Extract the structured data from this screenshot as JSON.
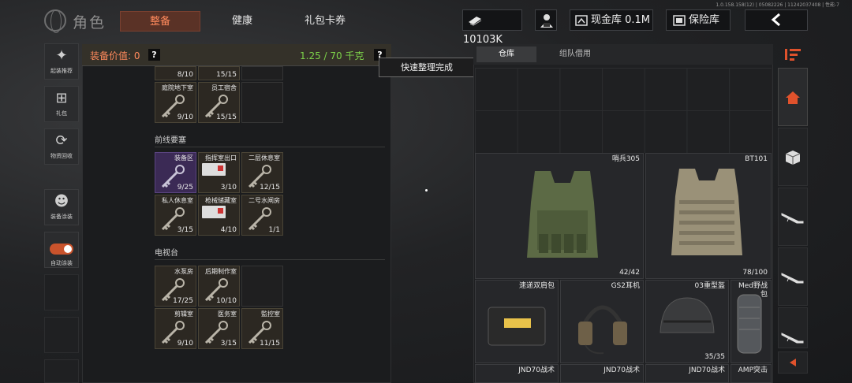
{
  "header": {
    "title": "角色",
    "tabs": [
      {
        "label": "整备",
        "active": true
      },
      {
        "label": "健康",
        "active": false
      },
      {
        "label": "礼包卡券",
        "active": false
      }
    ],
    "version": "1.0.158.158(12) | 05082226 | 11242037408 | 性能-7",
    "currency": "10103K",
    "cash_vault": "现金库 0.1M",
    "safe": "保险库",
    "accent": "#ff8a5c"
  },
  "left_menu": [
    {
      "label": "起装推荐",
      "icon": "loadout-icon"
    },
    {
      "label": "礼包",
      "icon": "gift-icon"
    },
    {
      "label": "物资回收",
      "icon": "recycle-icon"
    },
    {
      "label": "装备涂装",
      "icon": "paint-icon"
    },
    {
      "label": "自动涂装",
      "icon": "toggle-icon"
    }
  ],
  "keys_panel": {
    "equip_value_label": "装备价值: 0",
    "help": "?",
    "weight": "1.25 / 70 千克",
    "weight_color": "#7dd34a",
    "top_partial": [
      {
        "count": "8/10"
      },
      {
        "count": "15/15"
      }
    ],
    "top_row": [
      {
        "name": "庭院地下室",
        "count": "9/10"
      },
      {
        "name": "员工宿舍",
        "count": "15/15"
      }
    ],
    "sections": [
      {
        "title": "前线要塞",
        "items": [
          {
            "name": "装备区",
            "count": "9/25",
            "rare": true
          },
          {
            "name": "指挥室出口",
            "count": "3/10",
            "card": true
          },
          {
            "name": "二层休息室",
            "count": "12/15"
          },
          {
            "name": "私人休息室",
            "count": "3/15"
          },
          {
            "name": "枪械储藏室",
            "count": "4/10",
            "card": true
          },
          {
            "name": "二号水闸房",
            "count": "1/1"
          }
        ]
      },
      {
        "title": "电视台",
        "items": [
          {
            "name": "水泵房",
            "count": "17/25"
          },
          {
            "name": "后期制作室",
            "count": "10/10"
          },
          {
            "name": "剪辑室",
            "count": "9/10"
          },
          {
            "name": "医务室",
            "count": "3/15"
          },
          {
            "name": "監控室",
            "count": "11/15"
          }
        ]
      }
    ]
  },
  "toast": "快速整理完成",
  "warehouse": {
    "tabs": [
      {
        "label": "仓库",
        "active": true
      },
      {
        "label": "组队借用",
        "active": false
      }
    ],
    "large": [
      {
        "name": "哨兵305",
        "count": "42/42"
      },
      {
        "name": "BT101",
        "count": "78/100"
      }
    ],
    "small": [
      {
        "name": "速递双肩包",
        "count": ""
      },
      {
        "name": "GS2耳机",
        "count": ""
      },
      {
        "name": "03重型盔",
        "count": "35/35"
      },
      {
        "name": "Med野战包",
        "count": ""
      }
    ],
    "bottom": [
      {
        "name": "JND70战术"
      },
      {
        "name": "JND70战术"
      },
      {
        "name": "JND70战术"
      },
      {
        "name": "AMP突击"
      }
    ]
  },
  "right_nav": [
    {
      "icon": "sort-icon"
    },
    {
      "icon": "home-icon",
      "active": true
    },
    {
      "icon": "box-icon"
    },
    {
      "icon": "rifle-icon"
    },
    {
      "icon": "rifle-icon"
    },
    {
      "icon": "rifle-icon"
    },
    {
      "icon": "arrow-left-icon"
    }
  ]
}
